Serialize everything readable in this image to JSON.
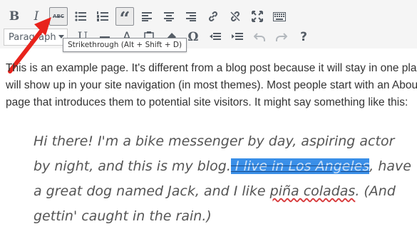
{
  "toolbar": {
    "row1": [
      {
        "name": "bold-icon",
        "glyph": "B",
        "active": false
      },
      {
        "name": "italic-icon",
        "glyph": "I",
        "active": false
      },
      {
        "name": "strikethrough-icon",
        "glyph": "ABC",
        "active": true
      },
      {
        "name": "bulleted-list-icon",
        "glyph": "",
        "active": false
      },
      {
        "name": "numbered-list-icon",
        "glyph": "",
        "active": false
      },
      {
        "name": "blockquote-icon",
        "glyph": "“",
        "active": true
      },
      {
        "name": "align-left-icon",
        "glyph": "",
        "active": false
      },
      {
        "name": "align-center-icon",
        "glyph": "",
        "active": false
      },
      {
        "name": "align-right-icon",
        "glyph": "",
        "active": false
      },
      {
        "name": "insert-link-icon",
        "glyph": "",
        "active": false
      },
      {
        "name": "remove-link-icon",
        "glyph": "",
        "active": false
      },
      {
        "name": "fullscreen-icon",
        "glyph": "",
        "active": false
      },
      {
        "name": "keyboard-icon",
        "glyph": "",
        "active": false
      }
    ],
    "format_select": {
      "value": "Paragraph"
    },
    "tooltip": "Strikethrough (Alt + Shift + D)"
  },
  "content": {
    "paragraph_lines": [
      "This is an example page. It's different from a blog post because it will stay in one place a",
      "will show up in your site navigation (in most themes). Most people start with an About",
      "page that introduces them to potential site visitors. It might say something like this:"
    ],
    "quote": {
      "line1": "Hi there! I'm a bike messenger by day, aspiring actor",
      "line2_before": "by night, and this is my blog.",
      "line2_selected": " I live in Los Angeles",
      "line2_after": ", have",
      "line3_before": "a great dog named Jack, and I like ",
      "line3_misspelled": "piña coladas",
      "line3_after": ". (And",
      "line4": "gettin' caught in the rain.)"
    }
  },
  "colors": {
    "toolbar_bg": "#f5f5f5",
    "selection": "#3a8fe8",
    "arrow": "#e8231c",
    "spellcheck": "#d63638"
  }
}
